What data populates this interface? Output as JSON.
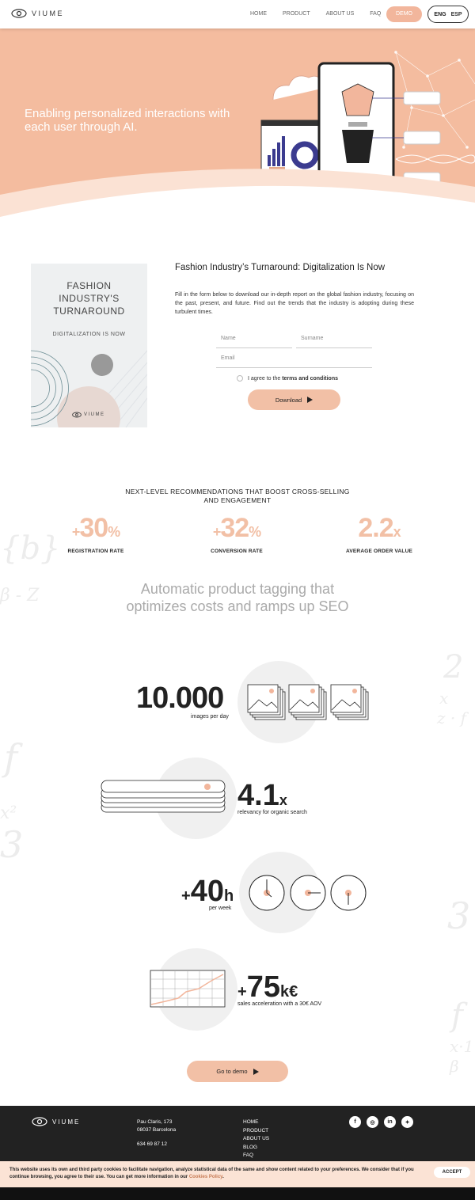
{
  "nav": {
    "logo": "VIUME",
    "links": [
      "HOME",
      "PRODUCT",
      "ABOUT US",
      "FAQ"
    ],
    "demo": "DEMO",
    "lang_active": "ENG",
    "lang_other": "ESP"
  },
  "hero": {
    "tagline": "Enabling personalized interactions with each user through AI."
  },
  "ebook": {
    "cover_title": "FASHION INDUSTRY'S TURNAROUND",
    "cover_subtitle": "DIGITALIZATION IS NOW",
    "cover_logo": "VIUME",
    "title": "Fashion Industry’s Turnaround: Digitalization Is Now",
    "description": "Fill in the form below to download our in-depth report on the global fashion industry, focusing on the past, present, and future. Find out the trends that the industry is adopting during these turbulent times.",
    "name_placeholder": "Name",
    "surname_placeholder": "Surname",
    "email_placeholder": "Email",
    "agree_prefix": "I agree to the ",
    "agree_link": "terms and conditions",
    "download": "Download"
  },
  "stats": {
    "title": "NEXT-LEVEL RECOMMENDATIONS THAT BOOST CROSS-SELLING AND ENGAGEMENT",
    "items": [
      {
        "prefix": "+",
        "value": "30",
        "suffix": "%",
        "label": "REGISTRATION RATE"
      },
      {
        "prefix": "+",
        "value": "32",
        "suffix": "%",
        "label": "CONVERSION RATE"
      },
      {
        "prefix": "",
        "value": "2.2",
        "suffix": "x",
        "label": "AVERAGE ORDER VALUE"
      }
    ]
  },
  "tagging": {
    "title": "Automatic product tagging that optimizes costs and ramps up SEO",
    "images_value": "10.000",
    "images_caption": "images per day",
    "relevancy_value": "4.1",
    "relevancy_suffix": "x",
    "relevancy_caption": "relevancy for organic search",
    "hours_prefix": "+",
    "hours_value": "40",
    "hours_suffix": "h",
    "hours_caption": "per week",
    "sales_prefix": "+",
    "sales_value": "75",
    "sales_suffix": "k€",
    "sales_caption": "sales acceleration with a 30€ AOV",
    "demo": "Go to demo"
  },
  "footer": {
    "logo": "VIUME",
    "address_1": "Pau Claris, 173",
    "address_2": "08037 Barcelona",
    "phone": "634 69 87 12",
    "links": [
      "HOME",
      "PRODUCT",
      "ABOUT US",
      "BLOG",
      "FAQ"
    ],
    "social": [
      "facebook-icon",
      "instagram-icon",
      "linkedin-icon",
      "twitter-icon"
    ]
  },
  "cookies": {
    "text": "This website uses its own and third party cookies to facilitate navigation, analyze statistical data of the same and show content related to your preferences. We consider that if you continue browsing, you agree to their use. You can get more information in our ",
    "link": "Cookies Policy",
    "end": ".",
    "accept": "ACCEPT"
  },
  "colors": {
    "accent": "#f4bc9f",
    "dark": "#222222"
  }
}
